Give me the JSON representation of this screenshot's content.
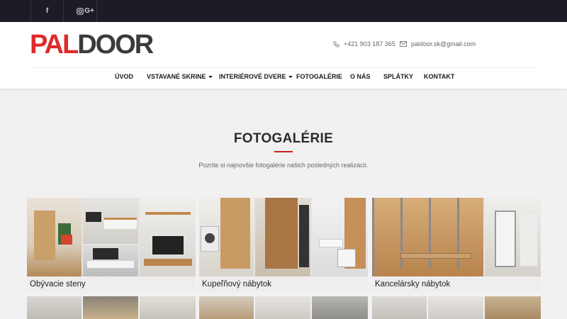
{
  "topbar": {
    "social": [
      {
        "icon": "facebook-icon",
        "glyph": "f"
      },
      {
        "icon": "instagram-icon",
        "glyph": ""
      },
      {
        "icon": "google-plus-icon",
        "glyph": "G+"
      }
    ]
  },
  "header": {
    "logo": {
      "part1": "PAL",
      "part2": "DOOR"
    },
    "phone": "+421 903 187 365",
    "email": "paldoor.sk@gmail.com"
  },
  "nav": {
    "items": [
      {
        "label": "ÚVOD",
        "dropdown": false
      },
      {
        "label": "VSTAVANÉ SKRINE",
        "dropdown": true
      },
      {
        "label": "INTERIÉROVÉ DVERE",
        "dropdown": true
      },
      {
        "label": "FOTOGALÉRIE",
        "dropdown": false
      },
      {
        "label": "O NÁS",
        "dropdown": false
      },
      {
        "label": "SPLÁTKY",
        "dropdown": false
      },
      {
        "label": "KONTAKT",
        "dropdown": false
      }
    ]
  },
  "main": {
    "title": "FOTOGALÉRIE",
    "subtitle": "Pozrite si najnovšie fotogalérie našich posledných realizácií."
  },
  "gallery": {
    "cards": [
      {
        "label": "Obývacie steny"
      },
      {
        "label": "Kupeľňový nábytok"
      },
      {
        "label": "Kancelársky nábytok"
      }
    ]
  },
  "colors": {
    "topbar_bg": "#1c1c26",
    "accent_red": "#c8201f",
    "logo_red": "#e02a2a",
    "page_bg": "#f1f1f1"
  }
}
